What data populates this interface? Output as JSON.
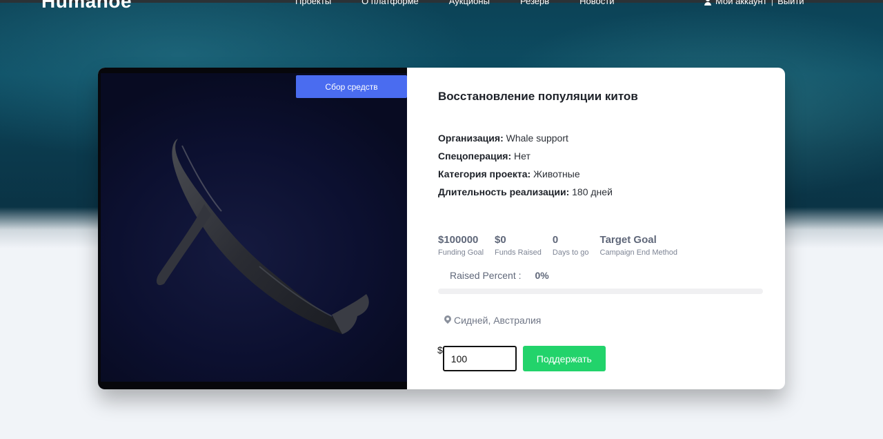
{
  "site": {
    "logo": "Humanoe"
  },
  "nav": {
    "items": [
      "Проекты",
      "О платформе",
      "Аукционы",
      "Резерв",
      "Новости"
    ]
  },
  "account": {
    "my_account": "Мой аккаунт",
    "separator": "|",
    "logout": "Выйти"
  },
  "campaign": {
    "badge": "Сбор средств",
    "title": "Восстановление популяции китов",
    "details": [
      {
        "label": "Организация:",
        "value": "Whale support"
      },
      {
        "label": "Спецоперация:",
        "value": "Нет"
      },
      {
        "label": "Категория проекта:",
        "value": "Животные"
      },
      {
        "label": "Длительность реализации:",
        "value": "180 дней"
      }
    ],
    "stats": [
      {
        "value": "$100000",
        "label": "Funding Goal"
      },
      {
        "value": "$0",
        "label": "Funds Raised"
      },
      {
        "value": "0",
        "label": "Days to go"
      },
      {
        "value": "Target Goal",
        "label": "Campaign End Method"
      }
    ],
    "raised_label": "Raised Percent :",
    "raised_value": "0%",
    "raised_fraction": 0,
    "location": "Сидней, Австралия",
    "currency_symbol": "$",
    "amount": "100",
    "donate_label": "Поддержать"
  },
  "colors": {
    "badge": "#4a6cf0",
    "accent": "#22d36b"
  }
}
